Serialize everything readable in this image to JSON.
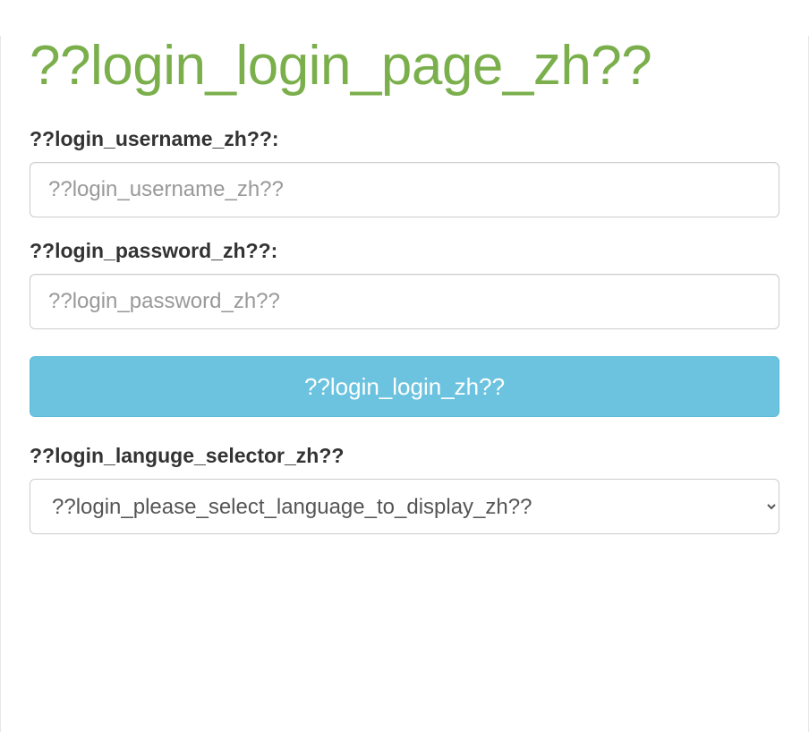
{
  "title": "??login_login_page_zh??",
  "username": {
    "label": "??login_username_zh??:",
    "placeholder": "??login_username_zh??"
  },
  "password": {
    "label": "??login_password_zh??:",
    "placeholder": "??login_password_zh??"
  },
  "login_button": "??login_login_zh??",
  "language": {
    "label": "??login_languge_selector_zh??",
    "selected": "??login_please_select_language_to_display_zh??"
  }
}
